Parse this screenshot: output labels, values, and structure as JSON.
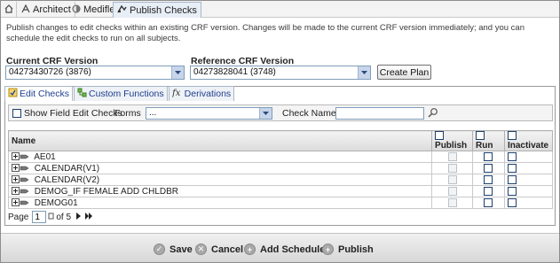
{
  "top_tabs": [
    {
      "label": "",
      "icon": "home-icon"
    },
    {
      "label": "Architect",
      "icon": "architect-icon"
    },
    {
      "label": "Mediflex",
      "icon": "mediflex-icon"
    },
    {
      "label": "Publish Checks",
      "icon": "publish-checks-icon",
      "active": true
    }
  ],
  "description": "Publish changes to edit checks within an existing CRF version. Changes will be made to the current CRF version immediately; and you can schedule the edit checks to run on all subjects.",
  "current_crf": {
    "label": "Current CRF Version",
    "value": "04273430726 (3876)"
  },
  "reference_crf": {
    "label": "Reference CRF Version",
    "value": "04273828041 (3748)"
  },
  "create_plan_label": "Create Plan",
  "sub_tabs": [
    {
      "label": "Edit Checks",
      "icon": "edit-checks-icon",
      "active": true
    },
    {
      "label": "Custom Functions",
      "icon": "custom-functions-icon"
    },
    {
      "label": "Derivations",
      "icon": "derivations-icon"
    }
  ],
  "filters": {
    "show_field_edit_checks_label": "Show Field Edit Checks",
    "forms_label": "Forms",
    "forms_value": "...",
    "check_name_label": "Check Name",
    "check_name_value": ""
  },
  "grid": {
    "columns": {
      "name": "Name",
      "publish": "Publish",
      "run": "Run",
      "inactivate": "Inactivate"
    },
    "rows": [
      {
        "name": "AE01"
      },
      {
        "name": "CALENDAR(V1)"
      },
      {
        "name": "CALENDAR(V2)"
      },
      {
        "name": "DEMOG_IF FEMALE ADD CHLDBR"
      },
      {
        "name": "DEMOG01"
      }
    ]
  },
  "pager": {
    "page_label": "Page",
    "page_value": "1",
    "of_label": "of 5"
  },
  "footer": {
    "save": "Save",
    "cancel": "Cancel",
    "add_schedule": "Add Schedule",
    "publish": "Publish"
  },
  "colors": {
    "link_blue": "#1f3f8f",
    "checkbox_border": "#1d3f6e",
    "footer_bg": "#d7d7d7"
  }
}
